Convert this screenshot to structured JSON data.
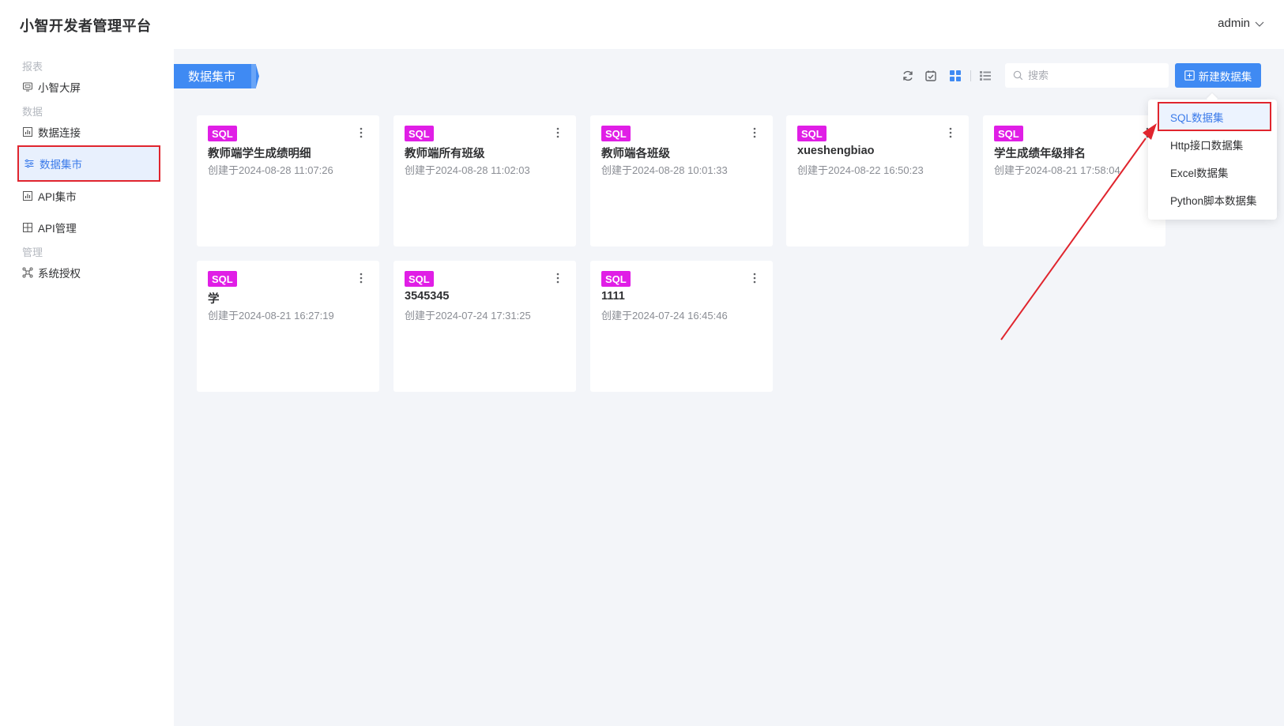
{
  "app": {
    "title": "小智开发者管理平台",
    "user": "admin"
  },
  "sidebar": {
    "sections": [
      {
        "label": "报表"
      },
      {
        "label": "数据"
      },
      {
        "label": "管理"
      }
    ],
    "items": [
      {
        "label": "小智大屏",
        "icon": "screen-icon"
      },
      {
        "label": "数据连接",
        "icon": "chart-icon"
      },
      {
        "label": "数据集市",
        "icon": "sliders-icon",
        "active": true
      },
      {
        "label": "API集市",
        "icon": "chart-icon"
      },
      {
        "label": "API管理",
        "icon": "grid-icon"
      },
      {
        "label": "系统授权",
        "icon": "network-icon"
      }
    ]
  },
  "main": {
    "tag_title": "数据集市",
    "toolbar": {
      "icons": [
        "refresh-icon",
        "checklist-icon",
        "grid-view-icon",
        "list-view-icon"
      ],
      "search_placeholder": "搜索",
      "new_button": "新建数据集"
    },
    "cards": [
      {
        "badge": "SQL",
        "name": "教师端学生成绩明细",
        "created": "创建于2024-08-28 11:07:26"
      },
      {
        "badge": "SQL",
        "name": "教师端所有班级",
        "created": "创建于2024-08-28 11:02:03"
      },
      {
        "badge": "SQL",
        "name": "教师端各班级",
        "created": "创建于2024-08-28 10:01:33"
      },
      {
        "badge": "SQL",
        "name": "xueshengbiao",
        "created": "创建于2024-08-22 16:50:23"
      },
      {
        "badge": "SQL",
        "name": "学生成绩年级排名",
        "created": "创建于2024-08-21 17:58:04"
      },
      {
        "badge": "SQL",
        "name": "学",
        "created": "创建于2024-08-21 16:27:19"
      },
      {
        "badge": "SQL",
        "name": "3545345",
        "created": "创建于2024-07-24 17:31:25"
      },
      {
        "badge": "SQL",
        "name": "1111",
        "created": "创建于2024-07-24 16:45:46"
      }
    ],
    "dropdown": [
      {
        "label": "SQL数据集",
        "active": true
      },
      {
        "label": "Http接口数据集"
      },
      {
        "label": "Excel数据集"
      },
      {
        "label": "Python脚本数据集"
      }
    ]
  },
  "colors": {
    "accent": "#3f8af3",
    "badge": "#e01ee6",
    "highlight": "#e0252e",
    "background": "#f3f5f9"
  }
}
